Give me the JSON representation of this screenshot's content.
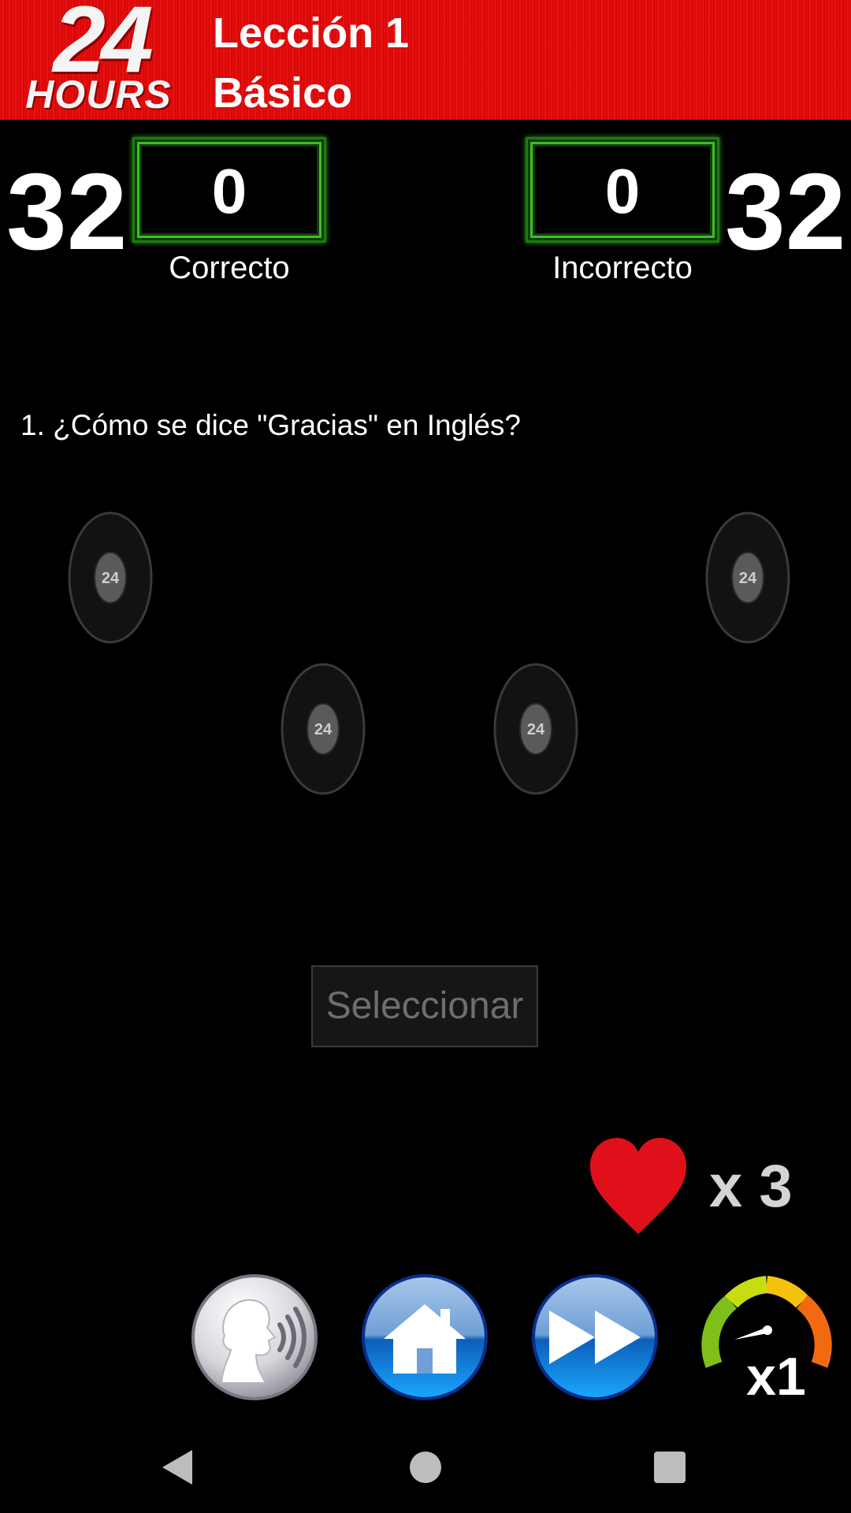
{
  "header": {
    "logo_number": "24",
    "logo_word": "HOURS",
    "title": "Lección 1",
    "subtitle": "Básico"
  },
  "score": {
    "left_total": "32",
    "right_total": "32",
    "correct_value": "0",
    "correct_label": "Correcto",
    "incorrect_value": "0",
    "incorrect_label": "Incorrecto"
  },
  "question": {
    "text": "1. ¿Cómo se dice \"Gracias\" en Inglés?"
  },
  "options": {
    "speaker_logo": "24"
  },
  "select_button": {
    "label": "Seleccionar"
  },
  "lives": {
    "label": "x 3"
  },
  "speed": {
    "label": "x1"
  },
  "icons": {
    "speak": "speaking-head-icon",
    "home": "home-icon",
    "next": "fast-forward-icon",
    "speed": "speedometer-icon",
    "heart": "heart-icon"
  },
  "colors": {
    "header_red": "#e10a0a",
    "box_green": "#3bbf24",
    "heart_red": "#e0101a",
    "button_blue": "#1e73d6"
  }
}
